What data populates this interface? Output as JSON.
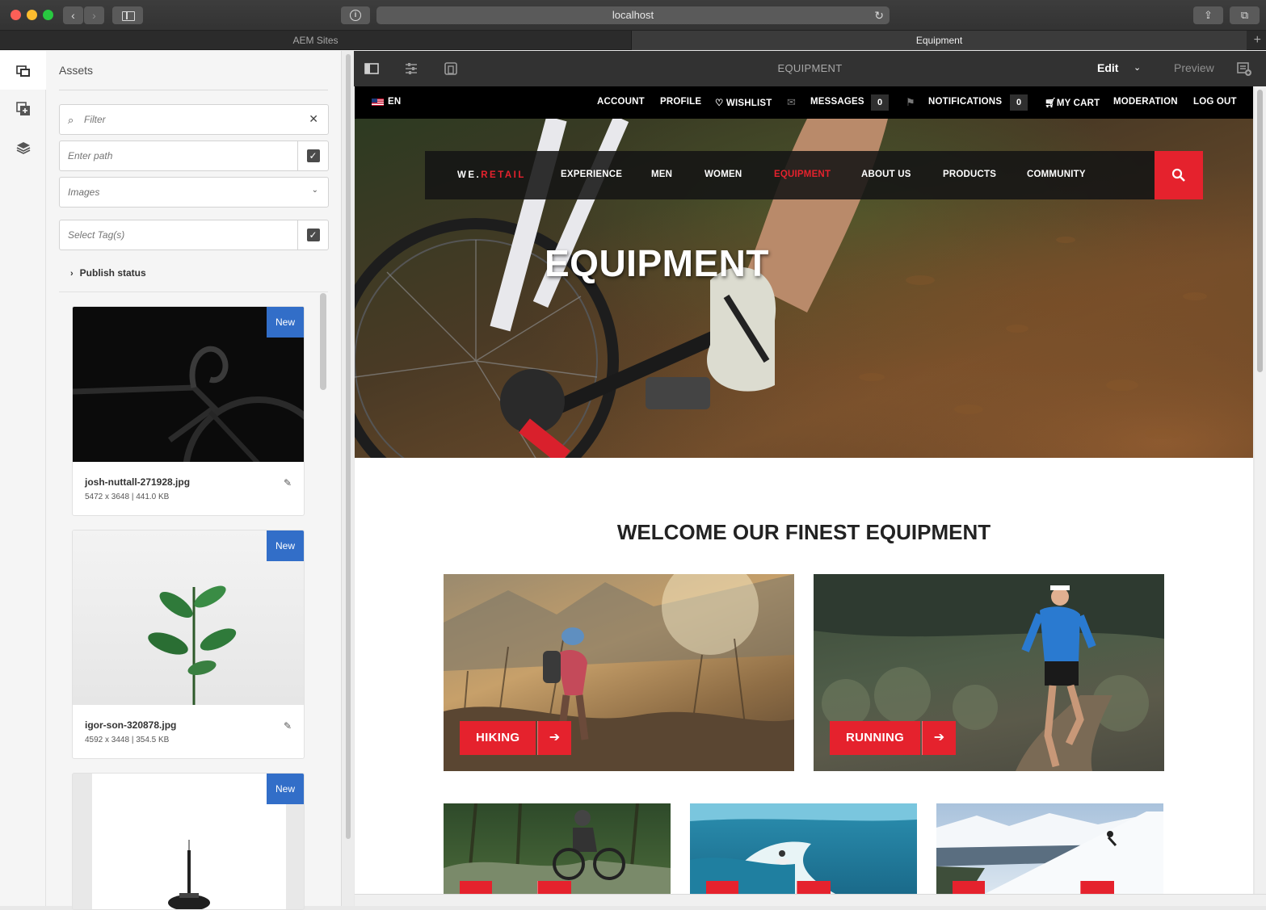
{
  "browser": {
    "url": "localhost",
    "tabs": [
      {
        "label": "AEM Sites",
        "active": false
      },
      {
        "label": "Equipment",
        "active": true
      }
    ],
    "new_tab": "+"
  },
  "assets_panel": {
    "title": "Assets",
    "filter_placeholder": "Filter",
    "path_placeholder": "Enter path",
    "type_select": "Images",
    "tags_placeholder": "Select Tag(s)",
    "publish_status": "Publish status",
    "cards": [
      {
        "name": "josh-nuttall-271928.jpg",
        "meta": "5472 x 3648 | 441.0 KB",
        "badge": "New"
      },
      {
        "name": "igor-son-320878.jpg",
        "meta": "4592 x 3448 | 354.5 KB",
        "badge": "New"
      },
      {
        "name": "",
        "meta": "",
        "badge": "New"
      }
    ]
  },
  "editor_toolbar": {
    "page_title": "EQUIPMENT",
    "mode": "Edit",
    "preview": "Preview"
  },
  "site": {
    "utility": {
      "language": "EN",
      "account": "ACCOUNT",
      "profile": "PROFILE",
      "wishlist": "WISHLIST",
      "messages": "MESSAGES",
      "messages_count": "0",
      "notifications": "NOTIFICATIONS",
      "notifications_count": "0",
      "cart": "MY CART",
      "moderation": "MODERATION",
      "logout": "LOG OUT"
    },
    "logo_main": "WE.",
    "logo_accent": "RETAIL",
    "nav": [
      "EXPERIENCE",
      "MEN",
      "WOMEN",
      "EQUIPMENT",
      "ABOUT US",
      "PRODUCTS",
      "COMMUNITY"
    ],
    "nav_active": "EQUIPMENT",
    "hero_title": "EQUIPMENT",
    "welcome": "WELCOME OUR FINEST EQUIPMENT",
    "tiles": [
      {
        "label": "HIKING"
      },
      {
        "label": "RUNNING"
      }
    ]
  },
  "colors": {
    "brand_red": "#e5222d",
    "badge_blue": "#326ec8",
    "toolbar_dark": "#323232"
  }
}
